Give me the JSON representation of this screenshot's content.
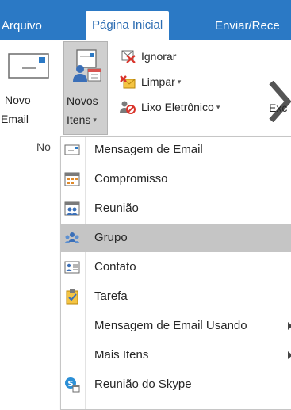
{
  "tabs": [
    {
      "label": "Arquivo"
    },
    {
      "label": "Página Inicial"
    },
    {
      "label": "Enviar/Rece"
    }
  ],
  "ribbon": {
    "novo_email": {
      "line1": "Novo",
      "line2": "Email"
    },
    "novos_itens": {
      "line1": "Novos",
      "line2": "Itens"
    },
    "ignorar": "Ignorar",
    "limpar": "Limpar",
    "lixo": "Lixo Eletrônico",
    "excluir_partial": "Exc",
    "group_label": "No"
  },
  "menu": {
    "items": [
      {
        "label": "Mensagem de Email",
        "icon": "envelope-icon"
      },
      {
        "label": "Compromisso",
        "icon": "calendar-icon"
      },
      {
        "label": "Reunião",
        "icon": "meeting-icon"
      },
      {
        "label": "Grupo",
        "icon": "group-icon",
        "highlighted": true
      },
      {
        "label": "Contato",
        "icon": "contact-card-icon"
      },
      {
        "label": "Tarefa",
        "icon": "task-clipboard-icon"
      },
      {
        "label": "Mensagem de Email Usando",
        "submenu": true
      },
      {
        "label": "Mais Itens",
        "submenu": true
      },
      {
        "label": "Reunião do Skype",
        "icon": "skype-meeting-icon"
      }
    ]
  },
  "colors": {
    "tabbar": "#2b79c5",
    "active_tab_text": "#2b6cb2",
    "highlight": "#c5c5c5"
  }
}
